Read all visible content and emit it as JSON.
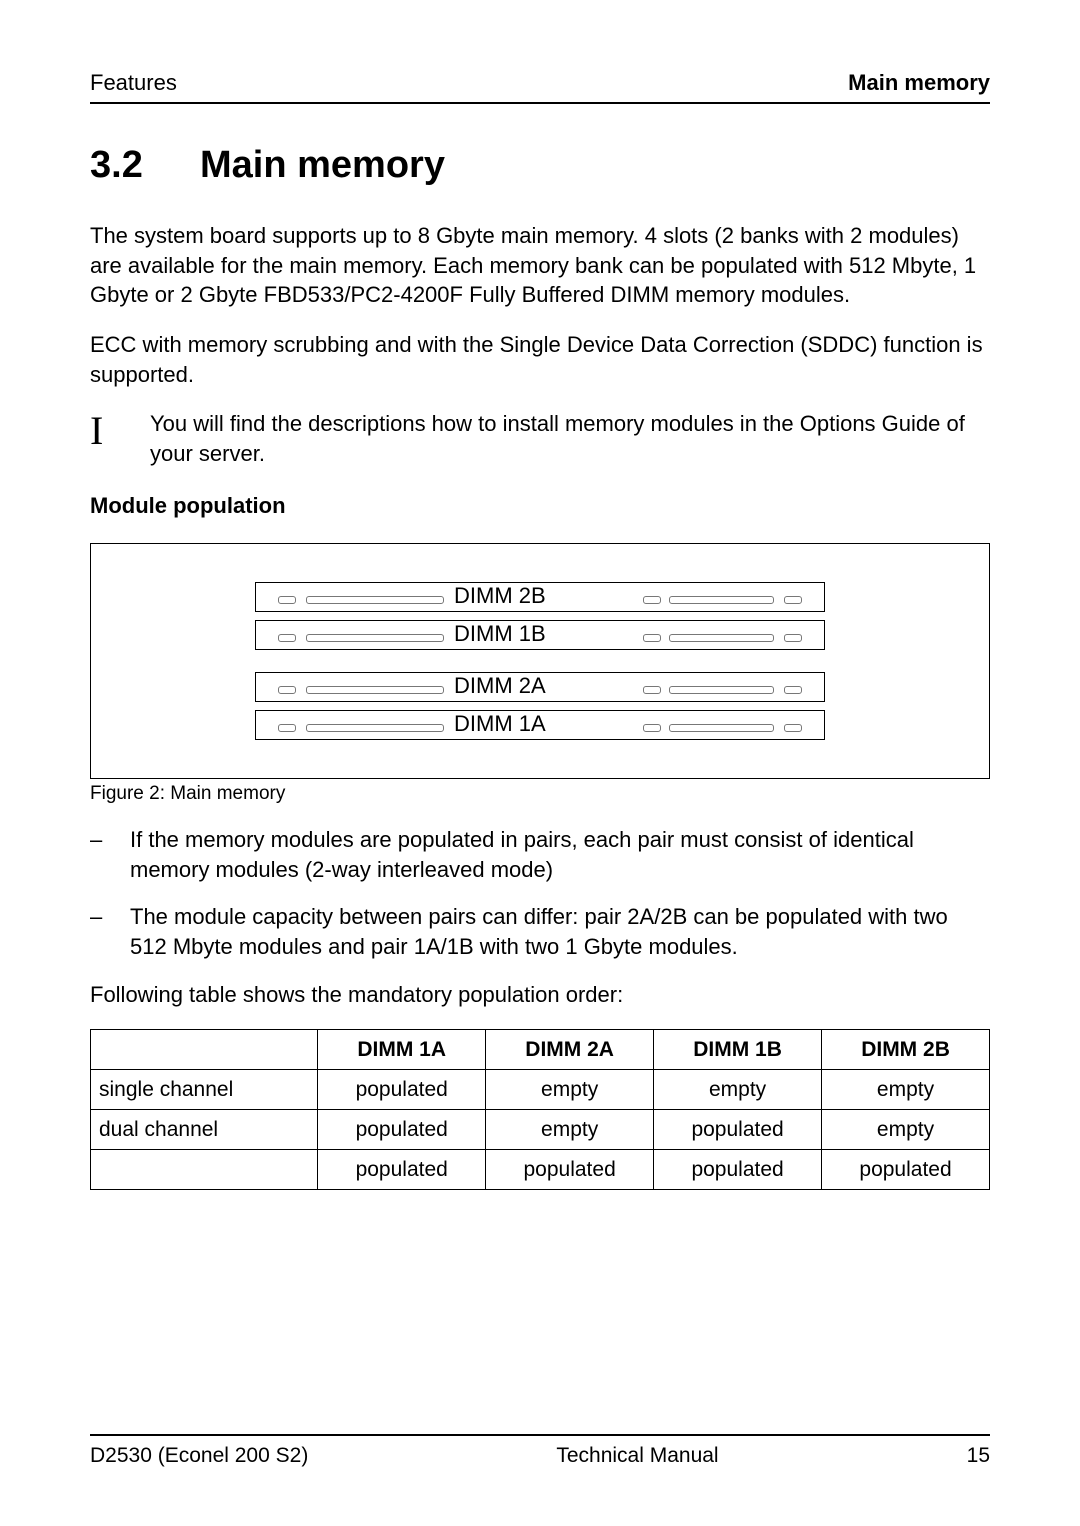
{
  "header": {
    "left": "Features",
    "right": "Main memory"
  },
  "heading": {
    "number": "3.2",
    "title": "Main memory"
  },
  "para1": "The system board supports up to 8 Gbyte main memory. 4 slots (2 banks with 2 modules) are available for the main memory. Each memory bank can be populated with 512 Mbyte, 1 Gbyte or 2 Gbyte FBD533/PC2-4200F Fully Buffered DIMM memory modules.",
  "para2": "ECC with memory scrubbing and with the Single Device Data Correction (SDDC) function is supported.",
  "note": {
    "icon": "I",
    "text": "You will find the descriptions how to install memory modules in the Options Guide of your server."
  },
  "subheading": "Module population",
  "figure": {
    "slots_top": [
      "DIMM 2B",
      "DIMM 1B"
    ],
    "slots_bottom": [
      "DIMM 2A",
      "DIMM 1A"
    ],
    "caption": "Figure 2: Main memory"
  },
  "bullets": [
    "If the memory modules are populated in pairs, each pair must consist of identical memory modules (2-way interleaved mode)",
    "The module capacity between pairs can differ: pair 2A/2B can be populated with two 512 Mbyte modules and pair 1A/1B with two 1 Gbyte modules."
  ],
  "table_intro": "Following table shows the mandatory population order:",
  "table": {
    "headers": [
      "",
      "DIMM 1A",
      "DIMM 2A",
      "DIMM 1B",
      "DIMM 2B"
    ],
    "rows": [
      [
        "single channel",
        "populated",
        "empty",
        "empty",
        "empty"
      ],
      [
        "dual channel",
        "populated",
        "empty",
        "populated",
        "empty"
      ],
      [
        "",
        "populated",
        "populated",
        "populated",
        "populated"
      ]
    ]
  },
  "footer": {
    "left": "D2530 (Econel 200 S2)",
    "center": "Technical Manual",
    "right": "15"
  }
}
